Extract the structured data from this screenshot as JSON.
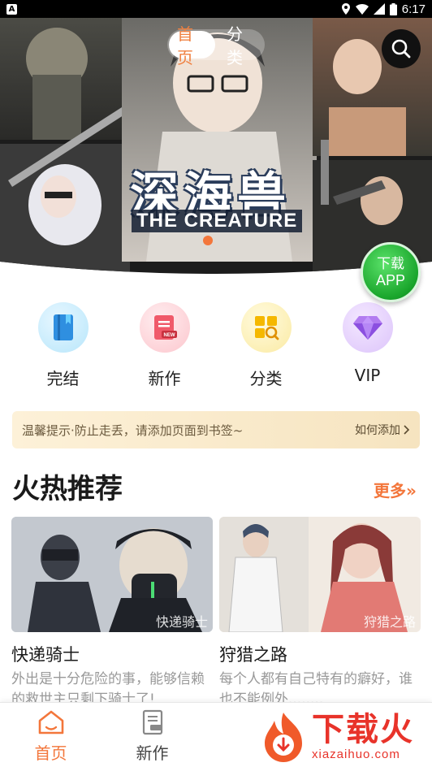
{
  "status_bar": {
    "time": "6:17",
    "left_icon": "A"
  },
  "header_tabs": {
    "home": "首页",
    "category": "分类"
  },
  "banner": {
    "title": "深海兽",
    "subtitle": "THE CREATURE"
  },
  "download_badge": {
    "line1": "下载",
    "line2": "APP"
  },
  "quick_menu": [
    {
      "label": "完结",
      "icon": "book-icon",
      "color": "#3aa8f0"
    },
    {
      "label": "新作",
      "icon": "new-doc-icon",
      "color": "#f05a6a"
    },
    {
      "label": "分类",
      "icon": "category-search-icon",
      "color": "#f5c020"
    },
    {
      "label": "VIP",
      "icon": "diamond-icon",
      "color": "#a070e0"
    }
  ],
  "tip": {
    "text": "温馨提示·防止走丢，请添加页面到书签~",
    "action": "如何添加"
  },
  "section": {
    "title": "火热推荐",
    "more": "更多»"
  },
  "cards": [
    {
      "title": "快递骑士",
      "desc": "外出是十分危险的事，能够信赖的救世主只剩下骑士了!",
      "cover_label": "快递骑士"
    },
    {
      "title": "狩猎之路",
      "desc": "每个人都有自己特有的癖好，谁也不能例外........",
      "cover_label": "狩猎之路"
    }
  ],
  "bottom_nav": [
    {
      "label": "首页",
      "icon": "home-icon",
      "active": true
    },
    {
      "label": "新作",
      "icon": "new-book-icon",
      "active": false
    }
  ],
  "watermark": {
    "cn": "下载火",
    "url": "xiazaihuo.com"
  },
  "colors": {
    "accent": "#f3763b",
    "tip_bg": "#fdf1d8",
    "download_green": "#19a52b"
  }
}
